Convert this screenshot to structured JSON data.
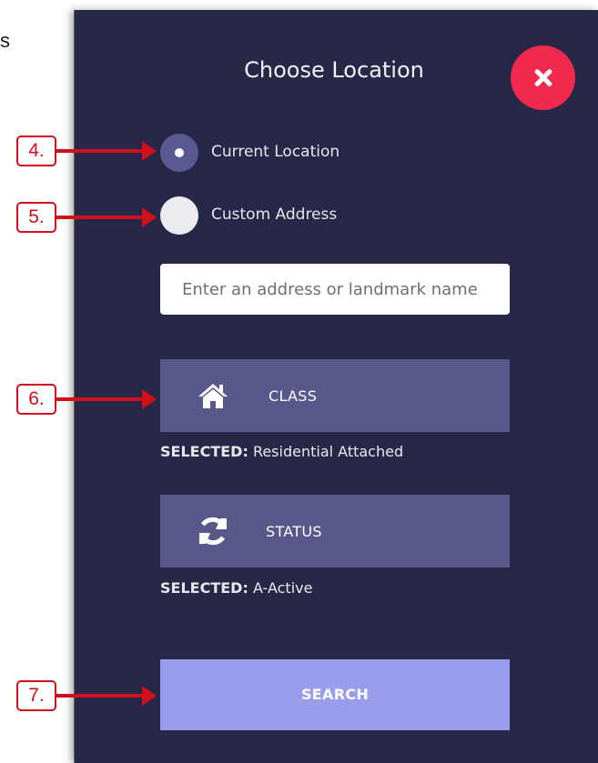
{
  "panel": {
    "title": "Choose Location",
    "close_icon": "close-x-icon"
  },
  "location_options": [
    {
      "label": "Current Location",
      "checked": true
    },
    {
      "label": "Custom Address",
      "checked": false
    }
  ],
  "address_input": {
    "placeholder": "Enter an address or landmark name",
    "value": ""
  },
  "filters": {
    "class": {
      "label": "CLASS",
      "icon": "home-icon",
      "selected_key": "SELECTED:",
      "selected_value": "Residential Attached"
    },
    "status": {
      "label": "STATUS",
      "icon": "refresh-icon",
      "selected_key": "SELECTED:",
      "selected_value": "A-Active"
    }
  },
  "search_button": {
    "label": "SEARCH"
  },
  "callouts": [
    "4.",
    "5.",
    "6.",
    "7."
  ],
  "colors": {
    "panel_bg": "#272848",
    "button_bg": "#58588a",
    "search_bg": "#9a9cec",
    "close_bg": "#f0294d",
    "callout": "#d0101a"
  }
}
